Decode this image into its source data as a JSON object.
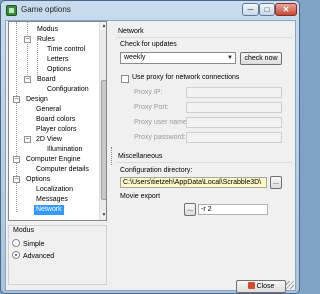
{
  "window": {
    "title": "Game options",
    "minimize_glyph": "─",
    "maximize_glyph": "□",
    "close_glyph": "✕"
  },
  "tree": {
    "items": [
      {
        "label": "Modus"
      },
      {
        "label": "Rules"
      },
      {
        "label": "Time control"
      },
      {
        "label": "Letters"
      },
      {
        "label": "Options"
      },
      {
        "label": "Board"
      },
      {
        "label": "Configuration"
      },
      {
        "label": "Design"
      },
      {
        "label": "General"
      },
      {
        "label": "Board colors"
      },
      {
        "label": "Player colors"
      },
      {
        "label": "2D View"
      },
      {
        "label": "Illumination"
      },
      {
        "label": "Computer Engine"
      },
      {
        "label": "Computer details"
      },
      {
        "label": "Options"
      },
      {
        "label": "Localization"
      },
      {
        "label": "Messages"
      },
      {
        "label": "Network"
      }
    ],
    "selected": "Network",
    "expander_glyph": "−",
    "scroll_up_glyph": "▲",
    "scroll_down_glyph": "▼"
  },
  "modus": {
    "title": "Modus",
    "options": [
      "Simple",
      "Advanced"
    ],
    "selected": "Advanced"
  },
  "network": {
    "title": "Network",
    "check_updates_label": "Check for updates",
    "check_updates_value": "weekly",
    "check_now_label": "check now",
    "use_proxy_label": "Use proxy for network connections",
    "proxy_ip_label": "Proxy IP:",
    "proxy_port_label": "Proxy Port:",
    "proxy_user_label": "Proxy user name:",
    "proxy_password_label": "Proxy password:"
  },
  "misc": {
    "title": "Miscellaneous",
    "config_dir_label": "Configuration directory:",
    "config_dir_value": "C:\\Users\\tietzeh\\AppData\\Local\\Scrabble3D\\",
    "browse_label": "...",
    "movie_export_label": "Movie export",
    "movie_browse_label": "...",
    "movie_args_value": "-r 2"
  },
  "footer": {
    "close_label": "Close"
  },
  "colors": {
    "selection": "#3399ff",
    "path_field": "#fdf8c6",
    "title_gradient_top": "#c9dbee"
  },
  "icons": {
    "app": "scrabble-app-icon",
    "close": "close-door-icon",
    "dropdown": "chevron-down-icon"
  }
}
